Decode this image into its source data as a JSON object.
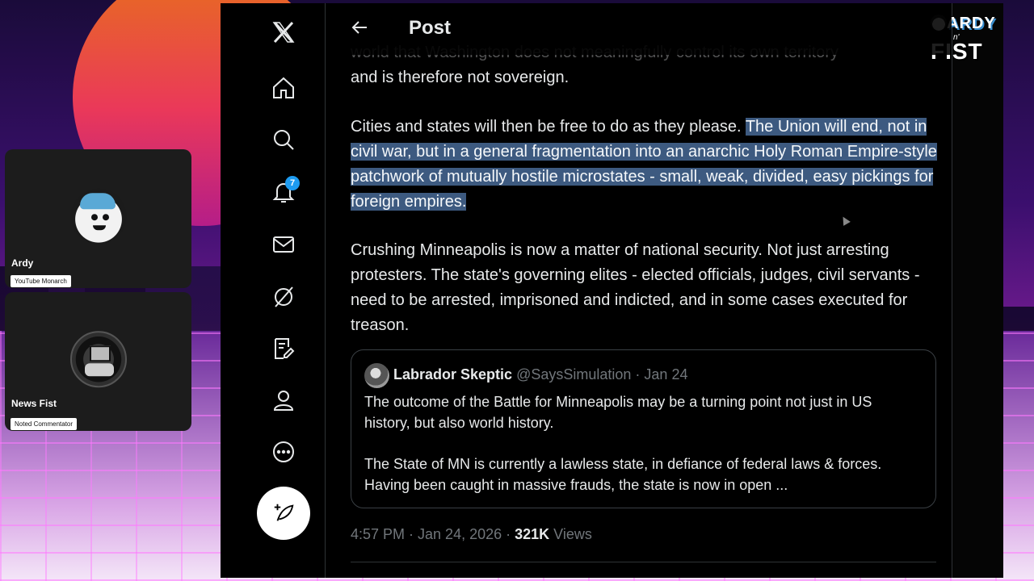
{
  "background": {
    "sun_color": "#ff5a2a",
    "grid_color": "#ff78ff"
  },
  "logo": {
    "top": "ARDY",
    "middle": "n'",
    "bottom": "FIST"
  },
  "cams": [
    {
      "name": "Ardy",
      "tag": "YouTube Monarch"
    },
    {
      "name": "News Fist",
      "tag": "Noted Commentator"
    }
  ],
  "nav": {
    "items": [
      "x-logo-icon",
      "home-icon",
      "search-icon",
      "bell-icon",
      "mail-icon",
      "grok-icon",
      "notes-icon",
      "profile-icon",
      "more-icon"
    ],
    "notifications_badge": "7",
    "compose_icon": "feather-plus-icon"
  },
  "header": {
    "title": "Post"
  },
  "tweet": {
    "faded_line": "world that Washington does not meaningfully control its own territory",
    "para1": "and is therefore not sovereign.",
    "para2_plain": "Cities and states will then be free to do as they please. ",
    "para2_highlight": "The Union will end, not in civil war, but in a general fragmentation into an anarchic Holy Roman Empire-style patchwork of mutually hostile microstates - small, weak, divided, easy pickings for foreign empires.",
    "para3": "Crushing Minneapolis is now a matter of national security. Not just arresting protesters. The state's governing elites - elected officials, judges, civil servants - need to be arrested, imprisoned and indicted, and in some cases executed for treason.",
    "highlight_color": "#3d5a80"
  },
  "quote": {
    "name": "Labrador Skeptic",
    "handle": "@SaysSimulation",
    "date": "· Jan 24",
    "text1": "The outcome of the Battle for Minneapolis may be a turning point not just in US history, but also world history.",
    "text2": "The State of MN is currently a lawless state, in defiance of federal laws & forces. Having been caught in massive frauds, the state is now in open ..."
  },
  "meta": {
    "time": "4:57 PM · Jan 24, 2026 · ",
    "views_count": "321K",
    "views_label": " Views"
  }
}
